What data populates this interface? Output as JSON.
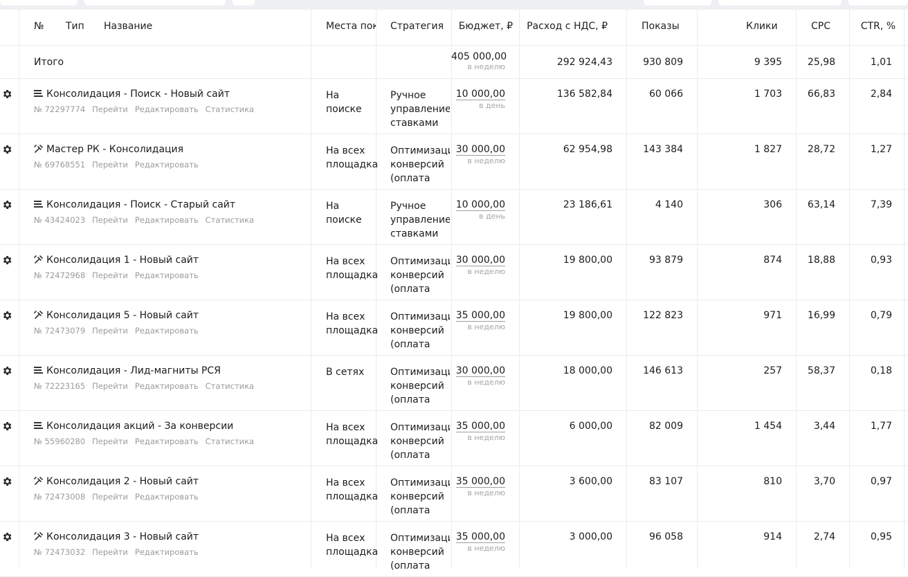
{
  "header": {
    "no": "№",
    "type": "Тип",
    "name": "Название",
    "places": "Места пок",
    "strategy": "Стратегия",
    "budget": "Бюджет, ₽",
    "spend": "Расход с НДС, ₽",
    "impressions": "Показы",
    "clicks": "Клики",
    "cpc": "CPC",
    "ctr": "CTR, %"
  },
  "total": {
    "label": "Итого",
    "budget": "405 000,00",
    "budget_period": "в неделю",
    "spend": "292 924,43",
    "impressions": "930 809",
    "clicks": "9 395",
    "cpc": "25,98",
    "ctr": "1,01"
  },
  "links": {
    "go": "Перейти",
    "edit": "Редактировать",
    "stats": "Статистика"
  },
  "campaigns": [
    {
      "type_icon": "text-campaign-icon",
      "name": "Консолидация - Поиск - Новый сайт",
      "id": "№ 72297774",
      "has_stats": true,
      "places": "На поиске",
      "strategy": "Ручное управление ставками",
      "budget": "10 000,00",
      "budget_period": "в день",
      "spend": "136 582,84",
      "impressions": "60 066",
      "clicks": "1 703",
      "cpc": "66,83",
      "ctr": "2,84"
    },
    {
      "type_icon": "master-campaign-icon",
      "name": "Мастер РК - Консолидация",
      "id": "№ 69768551",
      "has_stats": false,
      "places": "На всех площадка",
      "strategy": "Оптимизаци конверсий (оплата",
      "budget": "30 000,00",
      "budget_period": "в неделю",
      "spend": "62 954,98",
      "impressions": "143 384",
      "clicks": "1 827",
      "cpc": "28,72",
      "ctr": "1,27"
    },
    {
      "type_icon": "text-campaign-icon",
      "name": "Консолидация - Поиск - Старый сайт",
      "id": "№ 43424023",
      "has_stats": true,
      "places": "На поиске",
      "strategy": "Ручное управление ставками",
      "budget": "10 000,00",
      "budget_period": "в день",
      "spend": "23 186,61",
      "impressions": "4 140",
      "clicks": "306",
      "cpc": "63,14",
      "ctr": "7,39"
    },
    {
      "type_icon": "master-campaign-icon",
      "name": "Консолидация 1 - Новый сайт",
      "id": "№ 72472968",
      "has_stats": false,
      "places": "На всех площадка",
      "strategy": "Оптимизаци конверсий (оплата",
      "budget": "30 000,00",
      "budget_period": "в неделю",
      "spend": "19 800,00",
      "impressions": "93 879",
      "clicks": "874",
      "cpc": "18,88",
      "ctr": "0,93"
    },
    {
      "type_icon": "master-campaign-icon",
      "name": "Консолидация 5 - Новый сайт",
      "id": "№ 72473079",
      "has_stats": false,
      "places": "На всех площадка",
      "strategy": "Оптимизаци конверсий (оплата",
      "budget": "35 000,00",
      "budget_period": "в неделю",
      "spend": "19 800,00",
      "impressions": "122 823",
      "clicks": "971",
      "cpc": "16,99",
      "ctr": "0,79"
    },
    {
      "type_icon": "text-campaign-icon",
      "name": "Консолидация - Лид-магниты РСЯ",
      "id": "№ 72223165",
      "has_stats": true,
      "places": "В сетях",
      "strategy": "Оптимизаци конверсий (оплата",
      "budget": "30 000,00",
      "budget_period": "в неделю",
      "spend": "18 000,00",
      "impressions": "146 613",
      "clicks": "257",
      "cpc": "58,37",
      "ctr": "0,18"
    },
    {
      "type_icon": "text-campaign-icon",
      "name": "Консолидация акций - За конверсии",
      "id": "№ 55960280",
      "has_stats": true,
      "places": "На всех площадка",
      "strategy": "Оптимизаци конверсий (оплата",
      "budget": "35 000,00",
      "budget_period": "в неделю",
      "spend": "6 000,00",
      "impressions": "82 009",
      "clicks": "1 454",
      "cpc": "3,44",
      "ctr": "1,77"
    },
    {
      "type_icon": "master-campaign-icon",
      "name": "Консолидация 2 - Новый сайт",
      "id": "№ 72473008",
      "has_stats": false,
      "places": "На всех площадка",
      "strategy": "Оптимизаци конверсий (оплата",
      "budget": "35 000,00",
      "budget_period": "в неделю",
      "spend": "3 600,00",
      "impressions": "83 107",
      "clicks": "810",
      "cpc": "3,70",
      "ctr": "0,97"
    },
    {
      "type_icon": "master-campaign-icon",
      "name": "Консолидация 3 - Новый сайт",
      "id": "№ 72473032",
      "has_stats": false,
      "places": "На всех площадка",
      "strategy": "Оптимизаци конверсий (оплата",
      "budget": "35 000,00",
      "budget_period": "в неделю",
      "spend": "3 000,00",
      "impressions": "96 058",
      "clicks": "914",
      "cpc": "2,74",
      "ctr": "0,95"
    }
  ]
}
